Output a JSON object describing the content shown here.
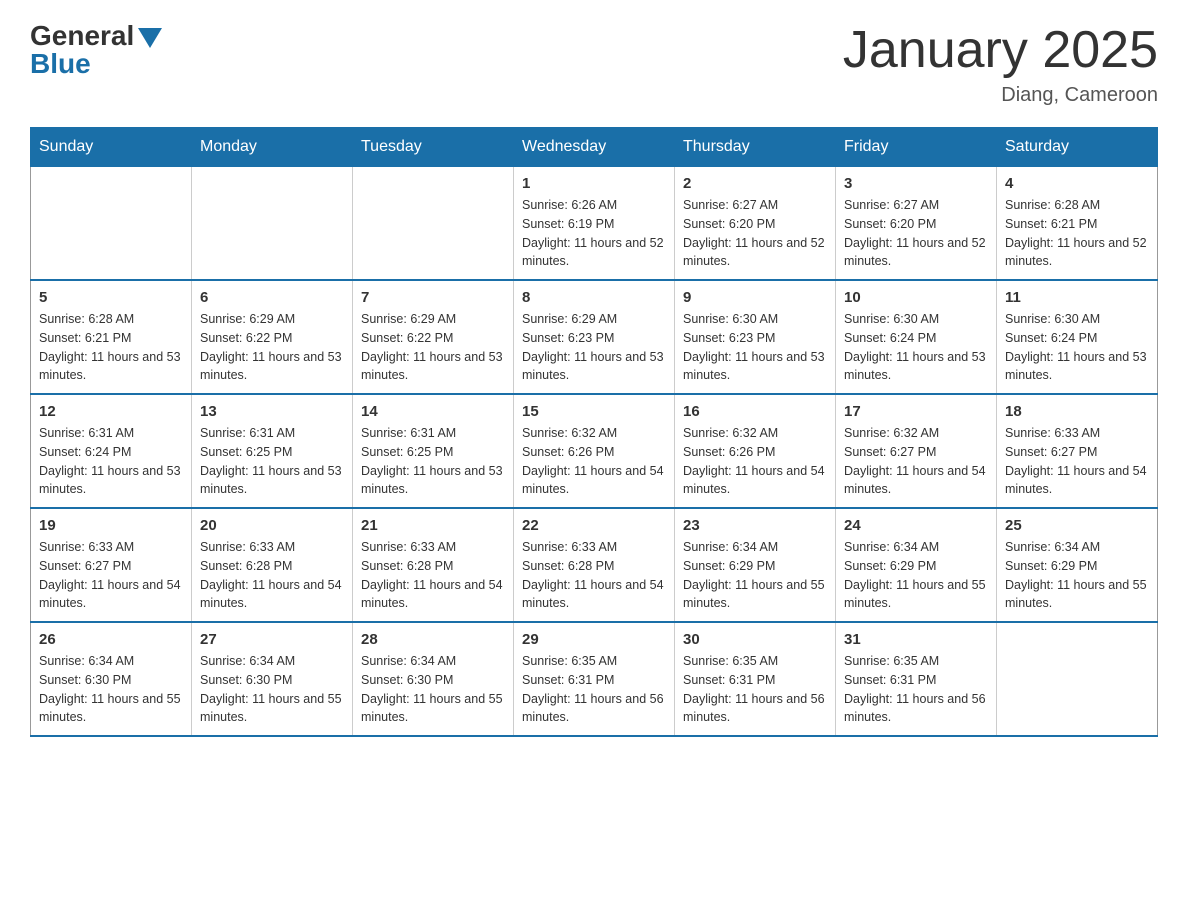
{
  "header": {
    "logo_general": "General",
    "logo_blue": "Blue",
    "title": "January 2025",
    "location": "Diang, Cameroon"
  },
  "days_of_week": [
    "Sunday",
    "Monday",
    "Tuesday",
    "Wednesday",
    "Thursday",
    "Friday",
    "Saturday"
  ],
  "weeks": [
    [
      {
        "day": "",
        "info": ""
      },
      {
        "day": "",
        "info": ""
      },
      {
        "day": "",
        "info": ""
      },
      {
        "day": "1",
        "info": "Sunrise: 6:26 AM\nSunset: 6:19 PM\nDaylight: 11 hours and 52 minutes."
      },
      {
        "day": "2",
        "info": "Sunrise: 6:27 AM\nSunset: 6:20 PM\nDaylight: 11 hours and 52 minutes."
      },
      {
        "day": "3",
        "info": "Sunrise: 6:27 AM\nSunset: 6:20 PM\nDaylight: 11 hours and 52 minutes."
      },
      {
        "day": "4",
        "info": "Sunrise: 6:28 AM\nSunset: 6:21 PM\nDaylight: 11 hours and 52 minutes."
      }
    ],
    [
      {
        "day": "5",
        "info": "Sunrise: 6:28 AM\nSunset: 6:21 PM\nDaylight: 11 hours and 53 minutes."
      },
      {
        "day": "6",
        "info": "Sunrise: 6:29 AM\nSunset: 6:22 PM\nDaylight: 11 hours and 53 minutes."
      },
      {
        "day": "7",
        "info": "Sunrise: 6:29 AM\nSunset: 6:22 PM\nDaylight: 11 hours and 53 minutes."
      },
      {
        "day": "8",
        "info": "Sunrise: 6:29 AM\nSunset: 6:23 PM\nDaylight: 11 hours and 53 minutes."
      },
      {
        "day": "9",
        "info": "Sunrise: 6:30 AM\nSunset: 6:23 PM\nDaylight: 11 hours and 53 minutes."
      },
      {
        "day": "10",
        "info": "Sunrise: 6:30 AM\nSunset: 6:24 PM\nDaylight: 11 hours and 53 minutes."
      },
      {
        "day": "11",
        "info": "Sunrise: 6:30 AM\nSunset: 6:24 PM\nDaylight: 11 hours and 53 minutes."
      }
    ],
    [
      {
        "day": "12",
        "info": "Sunrise: 6:31 AM\nSunset: 6:24 PM\nDaylight: 11 hours and 53 minutes."
      },
      {
        "day": "13",
        "info": "Sunrise: 6:31 AM\nSunset: 6:25 PM\nDaylight: 11 hours and 53 minutes."
      },
      {
        "day": "14",
        "info": "Sunrise: 6:31 AM\nSunset: 6:25 PM\nDaylight: 11 hours and 53 minutes."
      },
      {
        "day": "15",
        "info": "Sunrise: 6:32 AM\nSunset: 6:26 PM\nDaylight: 11 hours and 54 minutes."
      },
      {
        "day": "16",
        "info": "Sunrise: 6:32 AM\nSunset: 6:26 PM\nDaylight: 11 hours and 54 minutes."
      },
      {
        "day": "17",
        "info": "Sunrise: 6:32 AM\nSunset: 6:27 PM\nDaylight: 11 hours and 54 minutes."
      },
      {
        "day": "18",
        "info": "Sunrise: 6:33 AM\nSunset: 6:27 PM\nDaylight: 11 hours and 54 minutes."
      }
    ],
    [
      {
        "day": "19",
        "info": "Sunrise: 6:33 AM\nSunset: 6:27 PM\nDaylight: 11 hours and 54 minutes."
      },
      {
        "day": "20",
        "info": "Sunrise: 6:33 AM\nSunset: 6:28 PM\nDaylight: 11 hours and 54 minutes."
      },
      {
        "day": "21",
        "info": "Sunrise: 6:33 AM\nSunset: 6:28 PM\nDaylight: 11 hours and 54 minutes."
      },
      {
        "day": "22",
        "info": "Sunrise: 6:33 AM\nSunset: 6:28 PM\nDaylight: 11 hours and 54 minutes."
      },
      {
        "day": "23",
        "info": "Sunrise: 6:34 AM\nSunset: 6:29 PM\nDaylight: 11 hours and 55 minutes."
      },
      {
        "day": "24",
        "info": "Sunrise: 6:34 AM\nSunset: 6:29 PM\nDaylight: 11 hours and 55 minutes."
      },
      {
        "day": "25",
        "info": "Sunrise: 6:34 AM\nSunset: 6:29 PM\nDaylight: 11 hours and 55 minutes."
      }
    ],
    [
      {
        "day": "26",
        "info": "Sunrise: 6:34 AM\nSunset: 6:30 PM\nDaylight: 11 hours and 55 minutes."
      },
      {
        "day": "27",
        "info": "Sunrise: 6:34 AM\nSunset: 6:30 PM\nDaylight: 11 hours and 55 minutes."
      },
      {
        "day": "28",
        "info": "Sunrise: 6:34 AM\nSunset: 6:30 PM\nDaylight: 11 hours and 55 minutes."
      },
      {
        "day": "29",
        "info": "Sunrise: 6:35 AM\nSunset: 6:31 PM\nDaylight: 11 hours and 56 minutes."
      },
      {
        "day": "30",
        "info": "Sunrise: 6:35 AM\nSunset: 6:31 PM\nDaylight: 11 hours and 56 minutes."
      },
      {
        "day": "31",
        "info": "Sunrise: 6:35 AM\nSunset: 6:31 PM\nDaylight: 11 hours and 56 minutes."
      },
      {
        "day": "",
        "info": ""
      }
    ]
  ]
}
